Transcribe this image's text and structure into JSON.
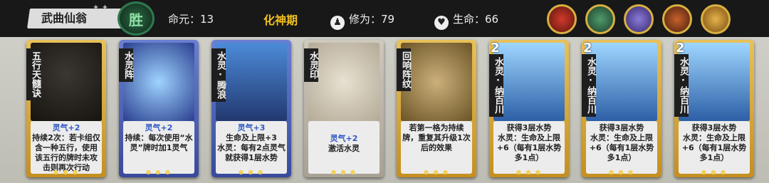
{
  "player": {
    "name": "武曲仙翁",
    "result": "胜"
  },
  "stats": {
    "life_label": "命元：",
    "life_value": "13",
    "realm": "化神期",
    "cultivation_label": "修为：",
    "cultivation_value": "79",
    "hp_label": "生命：",
    "hp_value": "66"
  },
  "portraits": [
    "portrait-1",
    "portrait-2",
    "portrait-3",
    "portrait-4",
    "portrait-5"
  ],
  "cards": [
    {
      "name": "五行天髓诀",
      "style": "gold",
      "level": "",
      "desc": [
        "灵气+2",
        "持续2次：若卡组仅含一种五行，使用该五行的牌时未攻击则再次行动"
      ]
    },
    {
      "name": "水灵阵",
      "style": "blue",
      "level": "",
      "desc": [
        "灵气+2",
        "持续：每次使用“水灵”牌时加1灵气"
      ]
    },
    {
      "name": "水灵·腾浪",
      "style": "blue",
      "level": "",
      "desc": [
        "灵气+3",
        "生命及上限+3",
        "水灵：每有2点灵气就获得1层水势"
      ]
    },
    {
      "name": "水灵印",
      "style": "grey",
      "level": "",
      "desc": [
        "灵气+2",
        "激活水灵"
      ]
    },
    {
      "name": "回响阵纹",
      "style": "gold",
      "level": "",
      "desc": [
        "若第一格为持续牌，重复其升级1次后的效果"
      ]
    },
    {
      "name": "水灵·纳百川",
      "style": "gold",
      "level": "2",
      "desc": [
        "获得3层水势",
        "水灵：生命及上限+6（每有1层水势多1点）"
      ]
    },
    {
      "name": "水灵·纳百川",
      "style": "gold",
      "level": "2",
      "desc": [
        "获得3层水势",
        "水灵：生命及上限+6（每有1层水势多1点）"
      ]
    },
    {
      "name": "水灵·纳百川",
      "style": "gold",
      "level": "2",
      "desc": [
        "获得3层水势",
        "水灵：生命及上限+6（每有1层水势多1点）"
      ]
    }
  ]
}
